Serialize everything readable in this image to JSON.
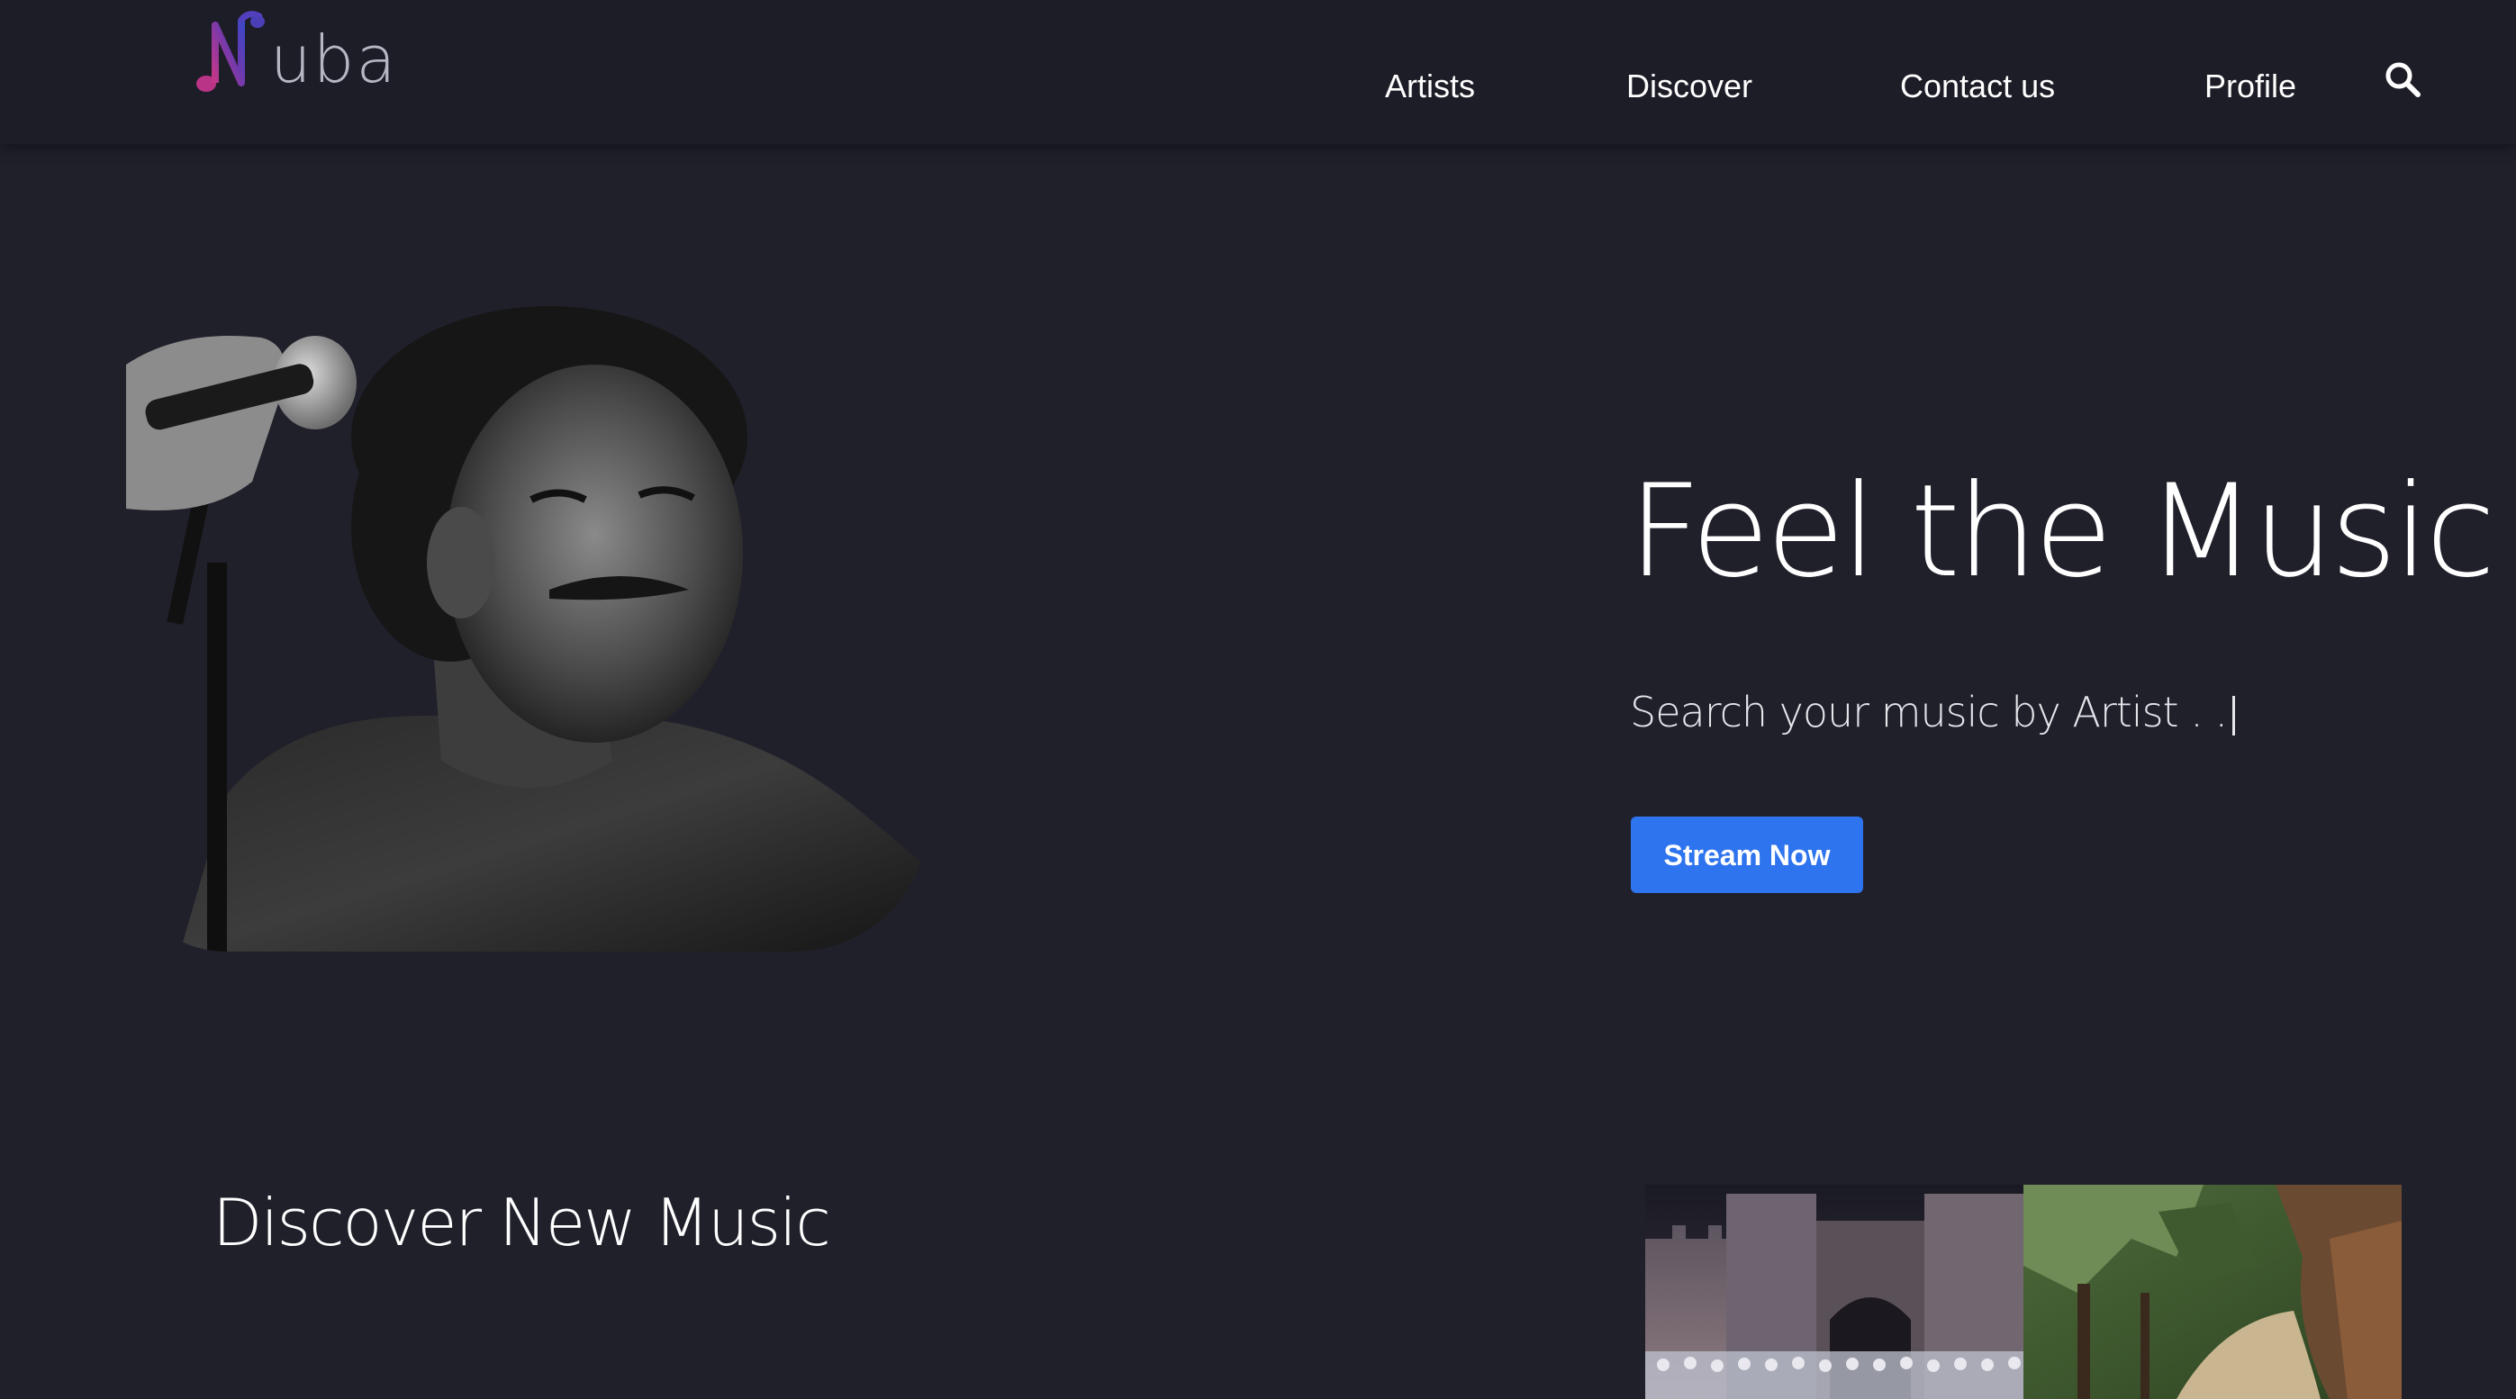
{
  "header": {
    "logo_text": "uba",
    "nav": {
      "artists": "Artists",
      "discover": "Discover",
      "contact": "Contact us",
      "profile": "Profile"
    },
    "search_icon": "search-icon"
  },
  "hero": {
    "title": "Feel the Music",
    "search_text": "Search your music by Artist . .",
    "cta_label": "Stream Now",
    "photo_icon": "artist-photo"
  },
  "discover": {
    "title": "Discover New Music"
  },
  "colors": {
    "background": "#20202b",
    "header": "#1d1d27",
    "accent": "#2e74ee",
    "logo_pink": "#b03a8c",
    "logo_purple": "#4b3fb8"
  }
}
